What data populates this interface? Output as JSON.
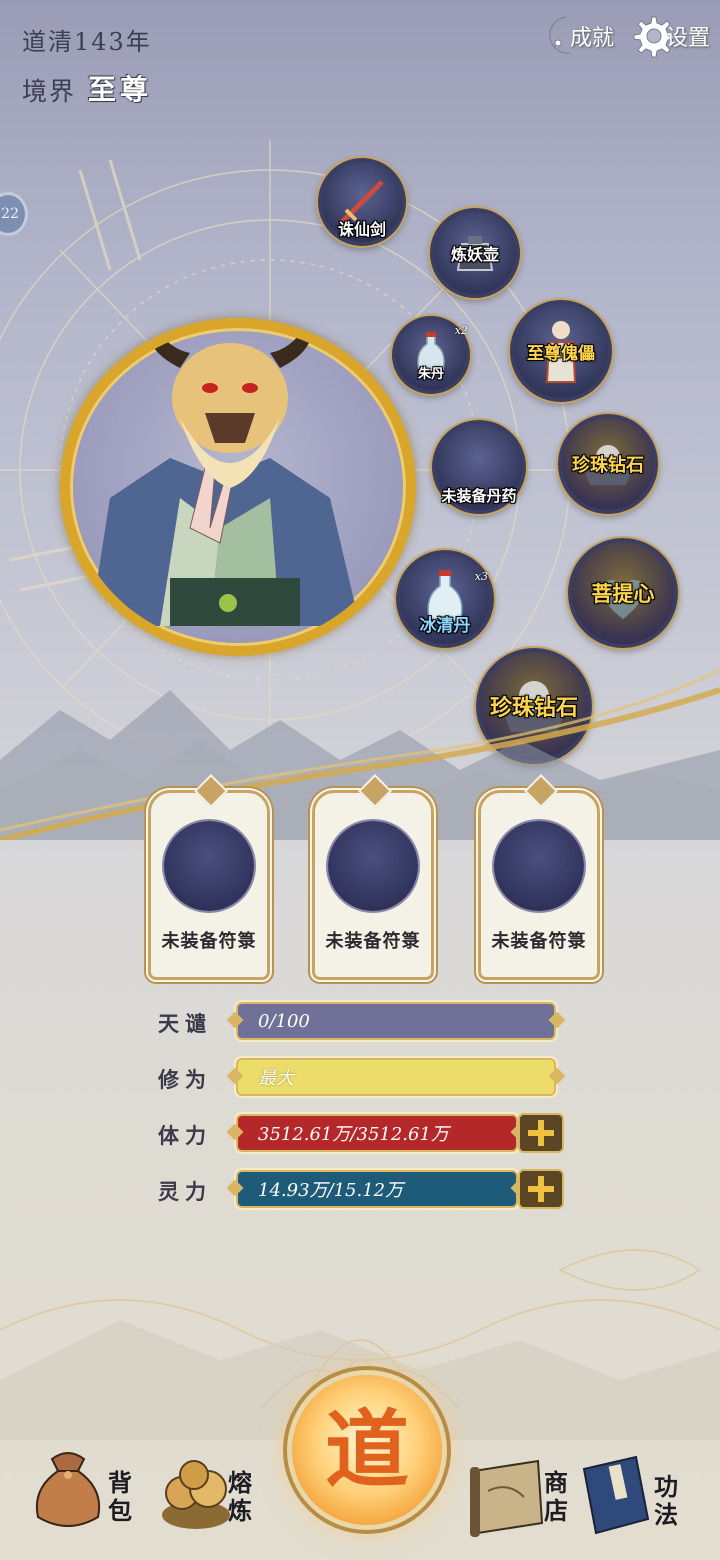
{
  "header": {
    "era": "道清143年",
    "realm_label": "境界",
    "realm_value": "至尊",
    "achievements_label": "成就",
    "settings_label": "设置"
  },
  "side_badge": "22",
  "equipment": {
    "sword": {
      "label": "诛仙剑"
    },
    "pot": {
      "label": "炼妖壶"
    },
    "pill1": {
      "label": "朱丹",
      "count": "x2"
    },
    "puppet": {
      "label": "至尊傀儡"
    },
    "pill_slot": {
      "label": "未装备丹药"
    },
    "pearl1": {
      "label": "珍珠钻石"
    },
    "pill2": {
      "label": "冰清丹",
      "count": "x3"
    },
    "bodhi": {
      "label": "菩提心"
    },
    "pearl2": {
      "label": "珍珠钻石"
    }
  },
  "talismans": [
    {
      "label": "未装备符箓"
    },
    {
      "label": "未装备符箓"
    },
    {
      "label": "未装备符箓"
    }
  ],
  "stats": {
    "tianqian": {
      "label": "天谴",
      "value": "0/100",
      "fraction": 0
    },
    "xiuwei": {
      "label": "修为",
      "value": "最大"
    },
    "tili": {
      "label": "体力",
      "value": "3512.61万/3512.61万"
    },
    "lingli": {
      "label": "灵力",
      "value": "14.93万/15.12万"
    }
  },
  "nav": {
    "bag": "背包",
    "smelt": "熔炼",
    "dao": "道",
    "shop": "商店",
    "skills": "功法"
  },
  "colors": {
    "tianqian_bar": "#6f7199",
    "xiuwei_bar": "#ecdd6a",
    "tili_bar": "#b5282a",
    "lingli_bar": "#1e5b78",
    "gold": "#d9b662"
  }
}
